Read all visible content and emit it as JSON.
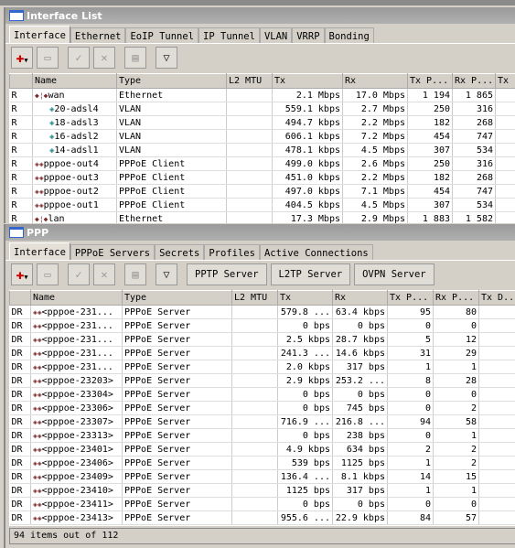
{
  "win1": {
    "title": "Interface List",
    "tabs": [
      "Interface",
      "Ethernet",
      "EoIP Tunnel",
      "IP Tunnel",
      "VLAN",
      "VRRP",
      "Bonding"
    ],
    "columns": [
      "",
      "Name",
      "Type",
      "L2 MTU",
      "Tx",
      "Rx",
      "Tx P...",
      "Rx P...",
      "Tx"
    ],
    "rows": [
      [
        "R",
        "wan",
        "Ethernet",
        "",
        "2.1 Mbps",
        "17.0 Mbps",
        "1 194",
        "1 865",
        0
      ],
      [
        "R",
        "20-adsl4",
        "VLAN",
        "",
        "559.1 kbps",
        "2.7 Mbps",
        "250",
        "316",
        1
      ],
      [
        "R",
        "18-adsl3",
        "VLAN",
        "",
        "494.7 kbps",
        "2.2 Mbps",
        "182",
        "268",
        1
      ],
      [
        "R",
        "16-adsl2",
        "VLAN",
        "",
        "606.1 kbps",
        "7.2 Mbps",
        "454",
        "747",
        1
      ],
      [
        "R",
        "14-adsl1",
        "VLAN",
        "",
        "478.1 kbps",
        "4.5 Mbps",
        "307",
        "534",
        1
      ],
      [
        "R",
        "pppoe-out4",
        "PPPoE Client",
        "",
        "499.0 kbps",
        "2.6 Mbps",
        "250",
        "316",
        2
      ],
      [
        "R",
        "pppoe-out3",
        "PPPoE Client",
        "",
        "451.0 kbps",
        "2.2 Mbps",
        "182",
        "268",
        2
      ],
      [
        "R",
        "pppoe-out2",
        "PPPoE Client",
        "",
        "497.0 kbps",
        "7.1 Mbps",
        "454",
        "747",
        2
      ],
      [
        "R",
        "pppoe-out1",
        "PPPoE Client",
        "",
        "404.5 kbps",
        "4.5 Mbps",
        "307",
        "534",
        2
      ],
      [
        "R",
        "lan",
        "Ethernet",
        "",
        "17.3 Mbps",
        "2.9 Mbps",
        "1 883",
        "1 582",
        0
      ]
    ]
  },
  "win2": {
    "title": "PPP",
    "tabs": [
      "Interface",
      "PPPoE Servers",
      "Secrets",
      "Profiles",
      "Active Connections"
    ],
    "buttons": [
      "PPTP Server",
      "L2TP Server",
      "OVPN Server"
    ],
    "columns": [
      "",
      "Name",
      "Type",
      "L2 MTU",
      "Tx",
      "Rx",
      "Tx P...",
      "Rx P...",
      "Tx D..."
    ],
    "rows": [
      [
        "DR",
        "<pppoe-231...",
        "PPPoE Server",
        "",
        "579.8 ...",
        "63.4 kbps",
        "95",
        "80"
      ],
      [
        "DR",
        "<pppoe-231...",
        "PPPoE Server",
        "",
        "0 bps",
        "0 bps",
        "0",
        "0"
      ],
      [
        "DR",
        "<pppoe-231...",
        "PPPoE Server",
        "",
        "2.5 kbps",
        "28.7 kbps",
        "5",
        "12"
      ],
      [
        "DR",
        "<pppoe-231...",
        "PPPoE Server",
        "",
        "241.3 ...",
        "14.6 kbps",
        "31",
        "29"
      ],
      [
        "DR",
        "<pppoe-231...",
        "PPPoE Server",
        "",
        "2.0 kbps",
        "317 bps",
        "1",
        "1"
      ],
      [
        "DR",
        "<pppoe-23203>",
        "PPPoE Server",
        "",
        "2.9 kbps",
        "253.2 ...",
        "8",
        "28"
      ],
      [
        "DR",
        "<pppoe-23304>",
        "PPPoE Server",
        "",
        "0 bps",
        "0 bps",
        "0",
        "0"
      ],
      [
        "DR",
        "<pppoe-23306>",
        "PPPoE Server",
        "",
        "0 bps",
        "745 bps",
        "0",
        "2"
      ],
      [
        "DR",
        "<pppoe-23307>",
        "PPPoE Server",
        "",
        "716.9 ...",
        "216.8 ...",
        "94",
        "58"
      ],
      [
        "DR",
        "<pppoe-23313>",
        "PPPoE Server",
        "",
        "0 bps",
        "238 bps",
        "0",
        "1"
      ],
      [
        "DR",
        "<pppoe-23401>",
        "PPPoE Server",
        "",
        "4.9 kbps",
        "634 bps",
        "2",
        "2"
      ],
      [
        "DR",
        "<pppoe-23406>",
        "PPPoE Server",
        "",
        "539 bps",
        "1125 bps",
        "1",
        "2"
      ],
      [
        "DR",
        "<pppoe-23409>",
        "PPPoE Server",
        "",
        "136.4 ...",
        "8.1 kbps",
        "14",
        "15"
      ],
      [
        "DR",
        "<pppoe-23410>",
        "PPPoE Server",
        "",
        "1125 bps",
        "317 bps",
        "1",
        "1"
      ],
      [
        "DR",
        "<pppoe-23411>",
        "PPPoE Server",
        "",
        "0 bps",
        "0 bps",
        "0",
        "0"
      ],
      [
        "DR",
        "<pppoe-23413>",
        "PPPoE Server",
        "",
        "955.6 ...",
        "22.9 kbps",
        "84",
        "57"
      ]
    ],
    "status": "94 items out of 112"
  },
  "icons": {
    "add": "plus-icon",
    "remove": "minus-icon",
    "enable": "check-icon",
    "disable": "x-icon",
    "comment": "note-icon",
    "filter": "filter-icon"
  },
  "colors": {
    "add": "#cc0000",
    "title_bar": "#a0a0a0"
  }
}
